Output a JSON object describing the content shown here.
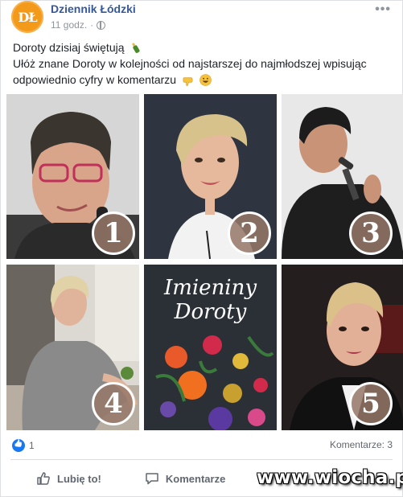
{
  "header": {
    "avatar_text": "DŁ",
    "page_name": "Dziennik Łódzki",
    "time": "11 godz.",
    "separator": "·",
    "more": "•••"
  },
  "post": {
    "line1": "Doroty dzisiaj świętują",
    "line2": "Ułóż znane Doroty w kolejności od najstarszej do najmłodszej wpisując",
    "line3": "odpowiednio cyfry w komentarzu"
  },
  "grid": {
    "numbers": [
      "1",
      "2",
      "3",
      "4",
      "5"
    ],
    "center_title_line1": "Imieniny",
    "center_title_line2": "Doroty"
  },
  "footer": {
    "likes": "1",
    "comments": "Komentarze: 3",
    "like_label": "Lubię to!",
    "comment_label": "Komentarze"
  },
  "watermark": "www.wiocha.pl",
  "colors": {
    "brand": "#365899",
    "avatar": "#f39a1a",
    "like": "#1877f2"
  }
}
